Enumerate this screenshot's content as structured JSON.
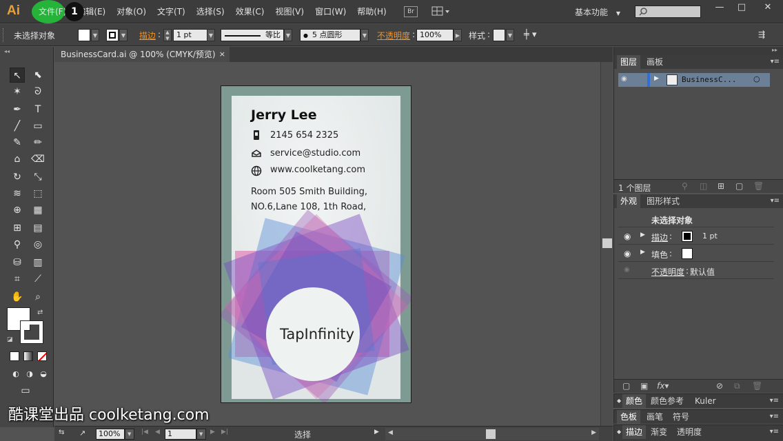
{
  "app": {
    "logo": "Ai"
  },
  "menu": {
    "items": [
      "文件(F)",
      "编辑(E)",
      "对象(O)",
      "文字(T)",
      "选择(S)",
      "效果(C)",
      "视图(V)",
      "窗口(W)",
      "帮助(H)"
    ],
    "step_badge": "1",
    "bridge_button": "Br",
    "workspace": "基本功能"
  },
  "controlbar": {
    "selection_status": "未选择对象",
    "stroke_label": "描边",
    "stroke_weight": "1 pt",
    "stroke_profile": "等比",
    "brush": "5 点圆形",
    "opacity_label": "不透明度",
    "opacity_value": "100%",
    "style_label": "样式"
  },
  "document": {
    "tab_title": "BusinessCard.ai @ 100% (CMYK/预览)",
    "close": "×"
  },
  "card": {
    "name": "Jerry Lee",
    "phone": "2145 654 2325",
    "email": "service@studio.com",
    "website": "www.coolketang.com",
    "address_line1": "Room 505 Smith Building,",
    "address_line2": "NO.6,Lane 108, 1th Road,",
    "brand": "TapInfinity"
  },
  "statusbar": {
    "zoom": "100%",
    "page": "1",
    "tool": "选择"
  },
  "panels": {
    "layers": {
      "tabs": [
        "图层",
        "画板"
      ],
      "layer_name": "BusinessC...",
      "count": "1 个图层"
    },
    "appearance": {
      "tabs": [
        "外观",
        "图形样式"
      ],
      "header": "未选择对象",
      "stroke_label": "描边",
      "stroke_value": "1 pt",
      "fill_label": "填色",
      "opacity_label": "不透明度",
      "opacity_value": "默认值"
    },
    "color": {
      "tabs": [
        "颜色",
        "颜色参考",
        "Kuler"
      ]
    },
    "swatches": {
      "tabs": [
        "色板",
        "画笔",
        "符号"
      ]
    },
    "stroke": {
      "tabs": [
        "描边",
        "渐变",
        "透明度"
      ]
    }
  },
  "watermark": "酷课堂出品 coolketang.com",
  "colors": {
    "accent_orange": "#e8932f",
    "highlight_green": "#25b33a",
    "artboard_bg": "#7d9a93"
  }
}
